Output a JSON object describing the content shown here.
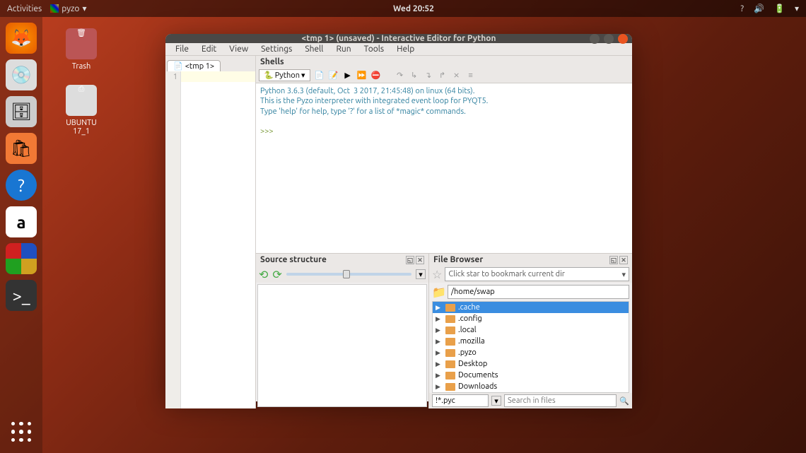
{
  "topbar": {
    "activities": "Activities",
    "app_name": "pyzo",
    "clock": "Wed 20:52"
  },
  "desktop": {
    "trash": "Trash",
    "usb": "UBUNTU 17_1"
  },
  "window": {
    "title": "<tmp 1> (unsaved) - Interactive Editor for Python",
    "menu": [
      "File",
      "Edit",
      "View",
      "Settings",
      "Shell",
      "Run",
      "Tools",
      "Help"
    ],
    "editor": {
      "tab": "<tmp 1>",
      "line1": "1"
    },
    "shells": {
      "header": "Shells",
      "python_tab": "Python",
      "output_line1": "Python 3.6.3 (default, Oct  3 2017, 21:45:48) on linux (64 bits).",
      "output_line2": "This is the Pyzo interpreter with integrated event loop for PYQT5.",
      "output_line3": "Type 'help' for help, type '?' for a list of *magic* commands.",
      "prompt": ">>>"
    },
    "source_structure": {
      "header": "Source structure"
    },
    "file_browser": {
      "header": "File Browser",
      "bookmark_placeholder": "Click star to bookmark current dir",
      "path": "/home/swap",
      "items": [
        ".cache",
        ".config",
        ".local",
        ".mozilla",
        ".pyzo",
        "Desktop",
        "Documents",
        "Downloads"
      ],
      "filter": "!*.pyc",
      "search_placeholder": "Search in files"
    }
  }
}
